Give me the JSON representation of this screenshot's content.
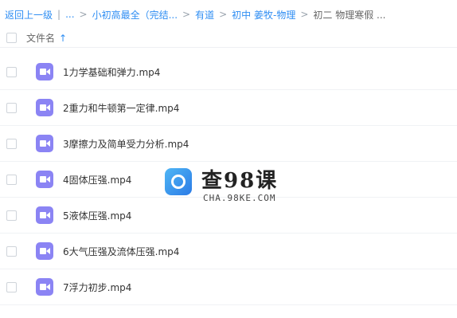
{
  "breadcrumb": {
    "back": "返回上一级",
    "ellipsis": "...",
    "items": [
      "小初高最全（完结...",
      "有道",
      "初中 姜牧-物理"
    ],
    "current": "初二 物理寒假 ..."
  },
  "list_header": {
    "name_label": "文件名",
    "sort_icon": "arrow-up-icon"
  },
  "files": [
    {
      "name": "1力学基础和弹力.mp4",
      "icon": "video-icon"
    },
    {
      "name": "2重力和牛顿第一定律.mp4",
      "icon": "video-icon"
    },
    {
      "name": "3摩擦力及简单受力分析.mp4",
      "icon": "video-icon"
    },
    {
      "name": "4固体压强.mp4",
      "icon": "video-icon"
    },
    {
      "name": "5液体压强.mp4",
      "icon": "video-icon"
    },
    {
      "name": "6大气压强及流体压强.mp4",
      "icon": "video-icon"
    },
    {
      "name": "7浮力初步.mp4",
      "icon": "video-icon"
    }
  ],
  "watermark": {
    "title": "查98课",
    "subtitle": "CHA.98KE.COM"
  },
  "colors": {
    "link": "#2f8ef3",
    "video_icon": "#8b84f4"
  }
}
